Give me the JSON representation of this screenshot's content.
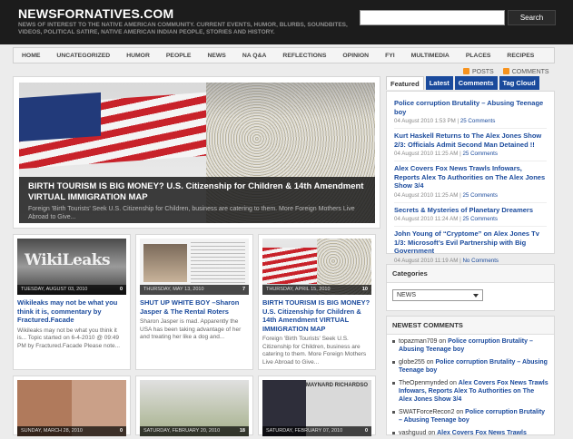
{
  "header": {
    "site_title": "NEWSFORNATIVES.COM",
    "tagline": "NEWS OF INTEREST TO THE NATIVE AMERICAN COMMUNITY. CURRENT EVENTS, HUMOR, BLURBS, SOUNDBITES, VIDEOS, POLITICAL SATIRE, NATIVE AMERICAN INDIAN PEOPLE, STORIES AND HISTORY.",
    "search_value": "",
    "search_button": "Search"
  },
  "nav": [
    "HOME",
    "UNCATEGORIZED",
    "HUMOR",
    "PEOPLE",
    "NEWS",
    "NA Q&A",
    "REFLECTIONS",
    "OPINION",
    "FYI",
    "MULTIMEDIA",
    "PLACES",
    "RECIPES"
  ],
  "toplinks": {
    "posts": "POSTS",
    "comments": "COMMENTS"
  },
  "featured": {
    "title": "BIRTH TOURISM IS BIG MONEY? U.S. Citizenship for Children & 14th Amendment VIRTUAL IMMIGRATION MAP",
    "excerpt": "Foreign 'Birth Tourists' Seek U.S. Citizenship for Children, business are catering to them. More Foreign Mothers Live Abroad to Give..."
  },
  "posts": [
    {
      "date": "TUESDAY, AUGUST 03, 2010",
      "comments": "0",
      "title": "Wikileaks may not be what you think it is, commentary by Fractured.Facade",
      "excerpt": "Wikileaks may not be what you think it is... Topic started on 6-4-2010 @ 09:49 PM by Fractured.Facade Please note..."
    },
    {
      "date": "THURSDAY, MAY 13, 2010",
      "comments": "7",
      "title": "SHUT UP WHITE BOY –Sharon Jasper & The Rental Roters",
      "excerpt": "Sharon Jasper is mad. Apparently the USA has been taking advantage of her and treating her like a dog and..."
    },
    {
      "date": "THURSDAY, APRIL 15, 2010",
      "comments": "10",
      "title": "BIRTH TOURISM IS BIG MONEY? U.S. Citizenship for Children & 14th Amendment VIRTUAL IMMIGRATION MAP",
      "excerpt": "Foreign 'Birth Tourists' Seek U.S. Citizenship for Children, business are catering to them. More Foreign Mothers Live Abroad to Give..."
    },
    {
      "date": "SUNDAY, MARCH 28, 2010",
      "comments": "0"
    },
    {
      "date": "SATURDAY, FEBRUARY 20, 2010",
      "comments": "18"
    },
    {
      "date": "SATURDAY, FEBRUARY 07, 2010",
      "comments": "0",
      "label": "MAYNARD RICHARDSO"
    }
  ],
  "sidebar": {
    "tabs": [
      "Featured",
      "Latest",
      "Comments",
      "Tag Cloud"
    ],
    "featured_items": [
      {
        "title": "Police corruption Brutality – Abusing Teenage boy",
        "date": "04 August 2010 1:53 PM",
        "comments": "25 Comments"
      },
      {
        "title": "Kurt Haskell Returns to The Alex Jones Show 2/3: Officials Admit Second Man Detained !!",
        "date": "04 August 2010 11:25 AM",
        "comments": "25 Comments"
      },
      {
        "title": "Alex Covers Fox News Trawls Infowars, Reports Alex To Authorities on The Alex Jones Show 3/4",
        "date": "04 August 2010 11:25 AM",
        "comments": "25 Comments"
      },
      {
        "title": "Secrets & Mysteries of Planetary Dreamers",
        "date": "04 August 2010 11:24 AM",
        "comments": "25 Comments"
      },
      {
        "title": "John Young of “Cryptome” on Alex Jones Tv 1/3: Microsoft’s Evil Partnership with Big Government",
        "date": "04 August 2010 11:19 AM",
        "comments": "No Comments"
      }
    ],
    "categories_heading": "Categories",
    "category_selected": "NEWS",
    "newest_comments_heading": "NEWEST COMMENTS",
    "newest_comments": [
      {
        "author": "topazman709",
        "on": "on",
        "title": "Police corruption Brutality – Abusing Teenage boy"
      },
      {
        "author": "globe255",
        "on": "on",
        "title": "Police corruption Brutality – Abusing Teenage boy"
      },
      {
        "author": "TheOpenmynded",
        "on": "on",
        "title": "Alex Covers Fox News Trawls Infowars, Reports Alex To Authorities on The Alex Jones Show 3/4"
      },
      {
        "author": "SWATForceRecon2",
        "on": "on",
        "title": "Police corruption Brutality – Abusing Teenage boy"
      },
      {
        "author": "vashguud",
        "on": "on",
        "title": "Alex Covers Fox News Trawls"
      }
    ]
  },
  "colors": {
    "link": "#1a4a9c",
    "header_bg": "#1c1c1c",
    "page_bg": "#ececec"
  }
}
